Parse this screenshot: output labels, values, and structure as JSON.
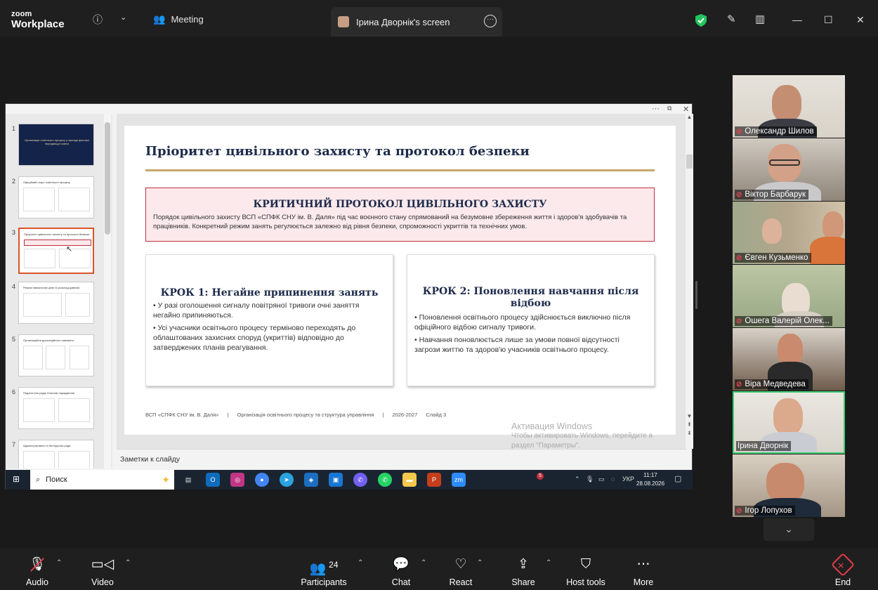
{
  "app": {
    "logo_line1": "zoom",
    "logo_line2": "Workplace",
    "meeting_label": "Meeting",
    "screen_tab_label": "Ірина Дворнік's screen"
  },
  "slide": {
    "title": "Пріоритет цивільного захисту та протокол безпеки",
    "critical_heading": "КРИТИЧНИЙ ПРОТОКОЛ ЦИВІЛЬНОГО ЗАХИСТУ",
    "critical_text": "Порядок цивільного захисту ВСП «СПФК СНУ ім. В. Даля» під час воєнного стану спрямований на безумовне збереження життя і здоров'я здобувачів та працівників. Конкретний режим занять регулюється залежно від рівня безпеки, спроможності укриттів та технічних умов.",
    "step1_heading": "КРОК 1: Негайне припинення занять",
    "step1_b1": "• У разі оголошення сигналу повітряної тривоги очні заняття негайно припиняються.",
    "step1_b2": "• Усі учасники освітнього процесу терміново переходять до облаштованих захисних споруд (укриттів) відповідно до затверджених планів реагування.",
    "step2_heading": "КРОК 2: Поновлення навчання після відбою",
    "step2_b1": "• Поновлення освітнього процесу здійснюється виключно після офіційного відбою сигналу тривоги.",
    "step2_b2": "• Навчання поновлюється лише за умови повної відсутності загрози життю та здоров'ю учасників освітнього процесу.",
    "footer_org": "ВСП «СПФК СНУ ім. В. Даля»",
    "footer_sep1": "|",
    "footer_topic": "Організація освітнього процесу та структура управління",
    "footer_sep2": "|",
    "footer_year": "2026-2027",
    "footer_slide": "Слайд 3"
  },
  "thumbnails": [
    {
      "num": "1",
      "title": "Організація освітнього процесу у закладі фахової передвищої освіти"
    },
    {
      "num": "2",
      "title": "Офіційний старт освітнього процесу"
    },
    {
      "num": "3",
      "title": "Пріоритет цивільного захисту та протокол безпеки"
    },
    {
      "num": "4",
      "title": "Режим навчальних днів та розклад дзвінків"
    },
    {
      "num": "5",
      "title": "Організаційна дистанційного навчання"
    },
    {
      "num": "6",
      "title": "Педагогічна рада: Ключові нарадження"
    },
    {
      "num": "7",
      "title": "Адміністративна та Методична ради"
    }
  ],
  "notes_placeholder": "Заметки к слайду",
  "taskbar": {
    "search_label": "Поиск",
    "lang": "УКР",
    "time": "11:17",
    "date": "28.08.2026",
    "badge": "5"
  },
  "watermark": {
    "line1": "Активация Windows",
    "line2": "Чтобы активировать Windows, перейдите в",
    "line3": "раздел \"Параметры\"."
  },
  "participants_gallery": [
    {
      "name": "Олександр Шилов"
    },
    {
      "name": "Віктор Барбарук"
    },
    {
      "name": "Євген Кузьменко"
    },
    {
      "name": "Ошега Валерій Олек..."
    },
    {
      "name": "Віра Медведева"
    },
    {
      "name": "Ірина Дворнік"
    },
    {
      "name": "Ігор Лопухов"
    }
  ],
  "toolbar": {
    "audio": "Audio",
    "video": "Video",
    "participants": "Participants",
    "participants_count": "24",
    "chat": "Chat",
    "react": "React",
    "share": "Share",
    "host_tools": "Host tools",
    "more": "More",
    "end": "End"
  },
  "colors": {
    "accent_green": "#3ecf73",
    "end_red": "#e23d4a",
    "shield_green": "#22c55e",
    "slide_navy": "#1d2a4a",
    "critical_border": "#c0303f",
    "thumb_selected": "#d9542b"
  }
}
